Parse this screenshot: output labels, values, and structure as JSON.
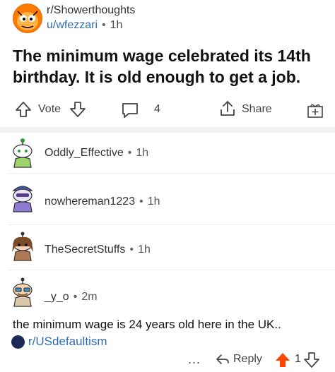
{
  "post": {
    "subreddit": "r/Showerthoughts",
    "author": "u/wfezzari",
    "time": "1h",
    "title": "The minimum wage celebrated its 14th birthday. It is old enough to get a job."
  },
  "actions": {
    "vote_label": "Vote",
    "comment_count": "4",
    "share_label": "Share"
  },
  "comments": [
    {
      "author": "Oddly_Effective",
      "time": "1h"
    },
    {
      "author": "nowhereman1223",
      "time": "1h"
    },
    {
      "author": "TheSecretStuffs",
      "time": "1h"
    },
    {
      "author": "_y_o",
      "time": "2m",
      "body": "the minimum wage is 24 years old here in the UK..",
      "link": "r/USdefaultism",
      "reply_label": "Reply",
      "score": "1",
      "more": "..."
    }
  ],
  "icons": {
    "vote_up": "arrow-up-outline-icon",
    "vote_down": "arrow-down-outline-icon",
    "comment": "comment-bubble-icon",
    "share": "share-icon",
    "award": "award-gift-icon",
    "reply": "reply-arrow-icon",
    "upvoted": "arrow-up-filled-icon"
  },
  "colors": {
    "link": "#2e6db4",
    "upvote": "#ff4500",
    "subreddit_avatar": "#ff7a00"
  }
}
